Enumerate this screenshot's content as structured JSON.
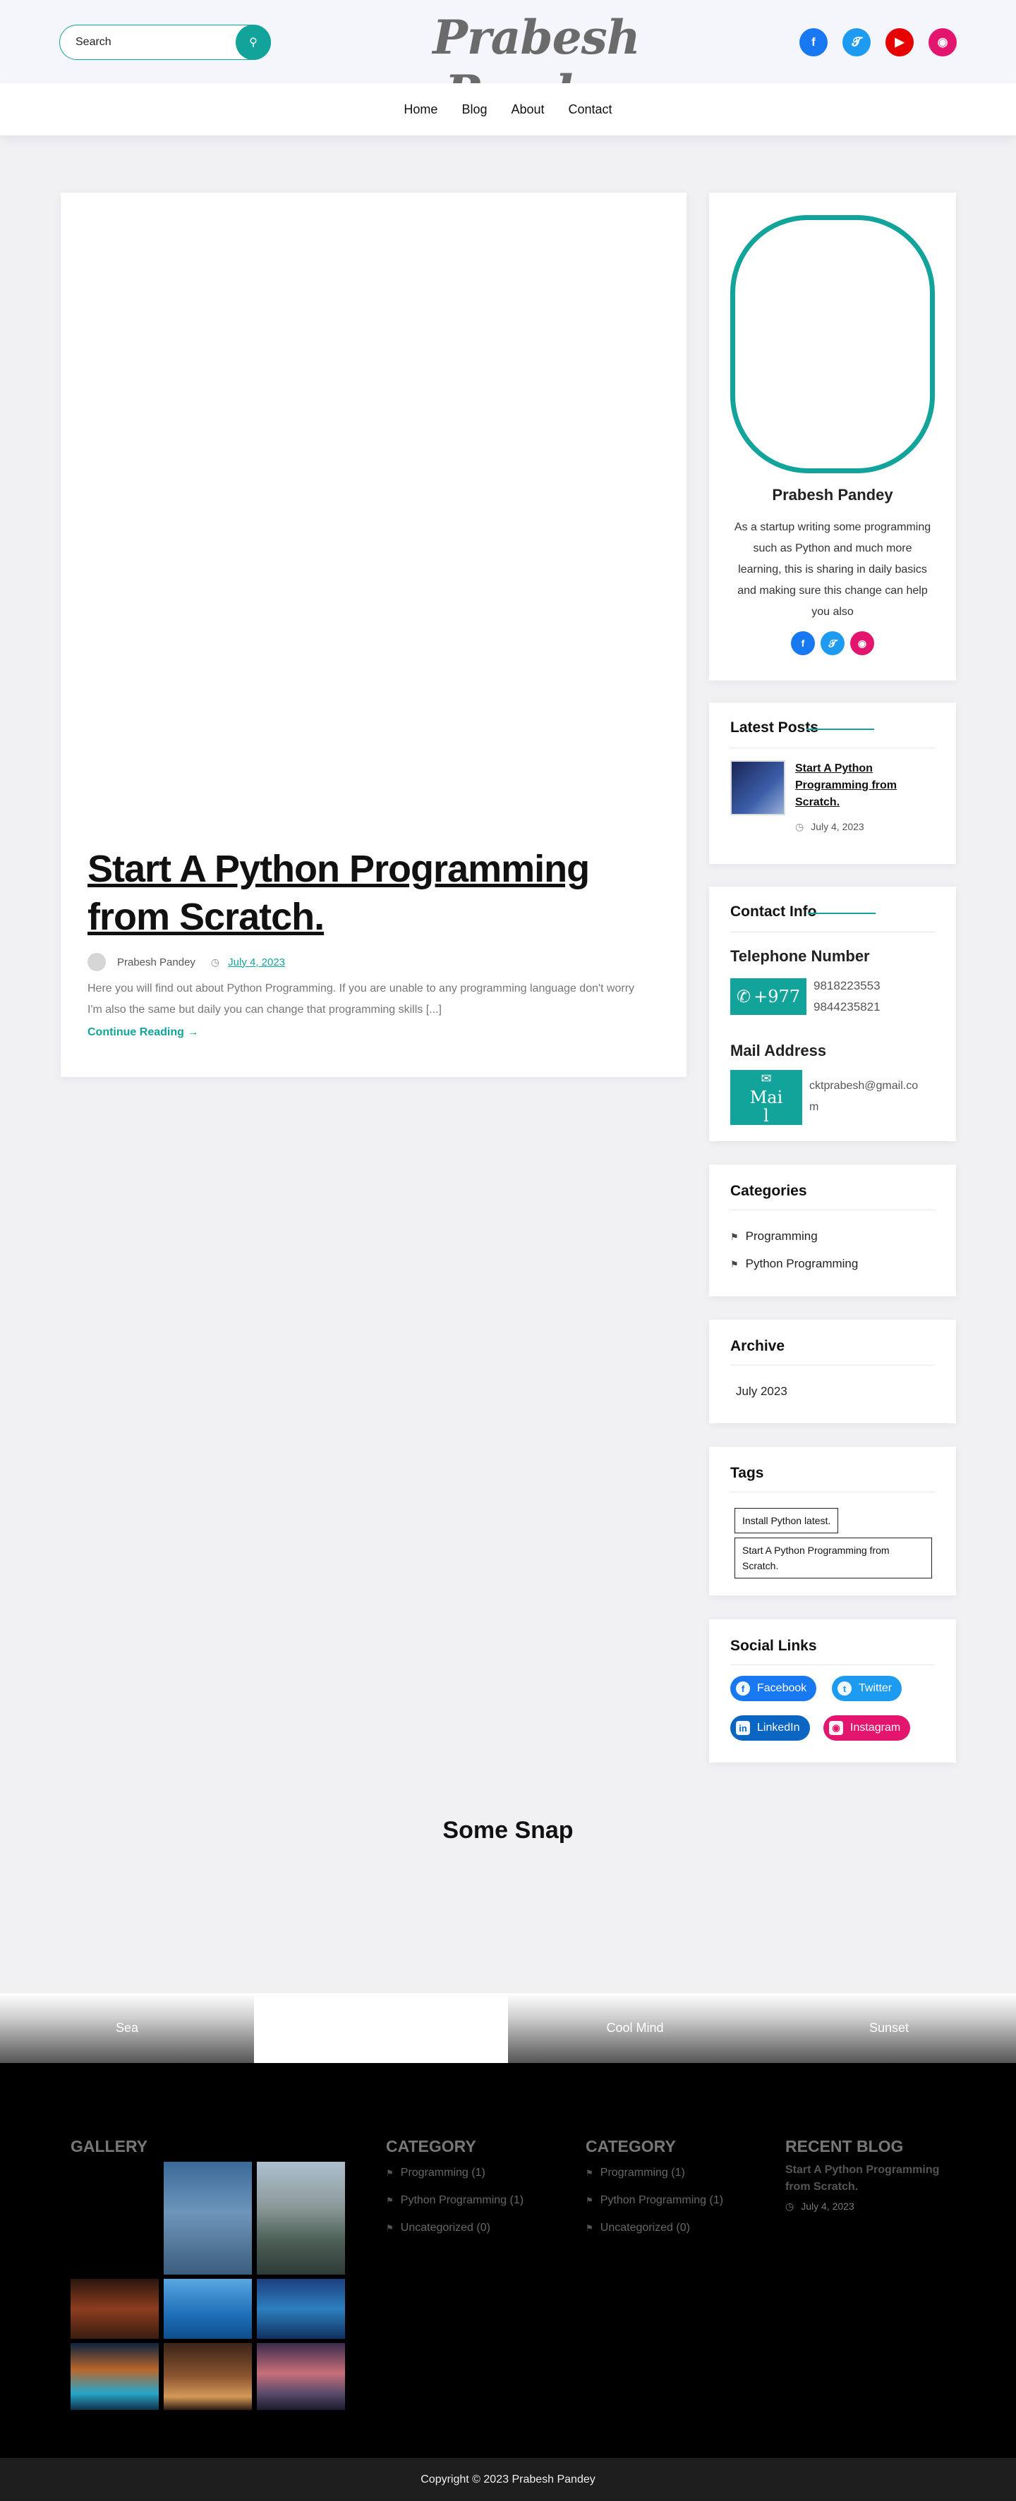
{
  "header": {
    "search_placeholder": "Search",
    "site_title": "Prabesh Pandey",
    "social": [
      "facebook-icon",
      "twitter-icon",
      "youtube-icon",
      "instagram-icon"
    ]
  },
  "nav": {
    "items": [
      "Home",
      "Blog",
      "About",
      "Contact"
    ]
  },
  "post": {
    "title": "Start A Python Programming from Scratch.",
    "author": "Prabesh Pandey",
    "date": "July 4, 2023",
    "excerpt": "Here you will find out about Python Programming. If you are unable to any programming language don't worry I'm also the same but daily you can change that programming skills [...]",
    "read_more": "Continue Reading →"
  },
  "about": {
    "name": "Prabesh Pandey",
    "text": "As a startup writing some programming such as Python and much more learning, this is sharing in daily basics and making sure this change can help you also"
  },
  "latest_posts": {
    "title": "Latest Posts",
    "items": [
      {
        "title": "Start A Python Programming from Scratch.",
        "date": "July 4, 2023"
      }
    ]
  },
  "contact": {
    "title": "Contact Info",
    "phone_heading": "Telephone Number",
    "phone_button": "+977",
    "phones": [
      "9818223553",
      "9844235821"
    ],
    "mail_heading": "Mail Address",
    "mail_button": "Mai l",
    "email_line1": "cktprabesh@gmail.co",
    "email_line2": "m"
  },
  "categories": {
    "title": "Categories",
    "items": [
      "Programming",
      "Python Programming"
    ]
  },
  "archive": {
    "title": "Archive",
    "items": [
      "July 2023"
    ]
  },
  "tags": {
    "title": "Tags",
    "items": [
      "Install Python latest.",
      "Start A Python Programming from",
      "Scratch."
    ]
  },
  "social_links": {
    "title": "Social Links",
    "items": [
      "Facebook",
      "Twitter",
      "LinkedIn",
      "Instagram"
    ]
  },
  "snap": {
    "title": "Some Snap",
    "items": [
      "Sea",
      "",
      "Cool Mind",
      "Sunset"
    ]
  },
  "footer": {
    "gallery_title": "GALLERY",
    "cat1_title": "CATEGORY",
    "cat1_items": [
      "Programming (1)",
      "Python Programming (1)",
      "Uncategorized (0)"
    ],
    "cat2_title": "CATEGORY",
    "cat2_items": [
      "Programming (1)",
      "Python Programming (1)",
      "Uncategorized (0)"
    ],
    "recent_title": "RECENT BLOG",
    "recent_post": "Start A Python Programming from Scratch.",
    "recent_date": "July 4, 2023",
    "copyright": "Copyright © 2023 Prabesh Pandey"
  },
  "colors": {
    "accent": "#12a39a",
    "facebook": "#1778f2",
    "twitter": "#1d9bf0",
    "youtube": "#e60000",
    "instagram": "#e4156f",
    "linkedin": "#0a66c2"
  }
}
